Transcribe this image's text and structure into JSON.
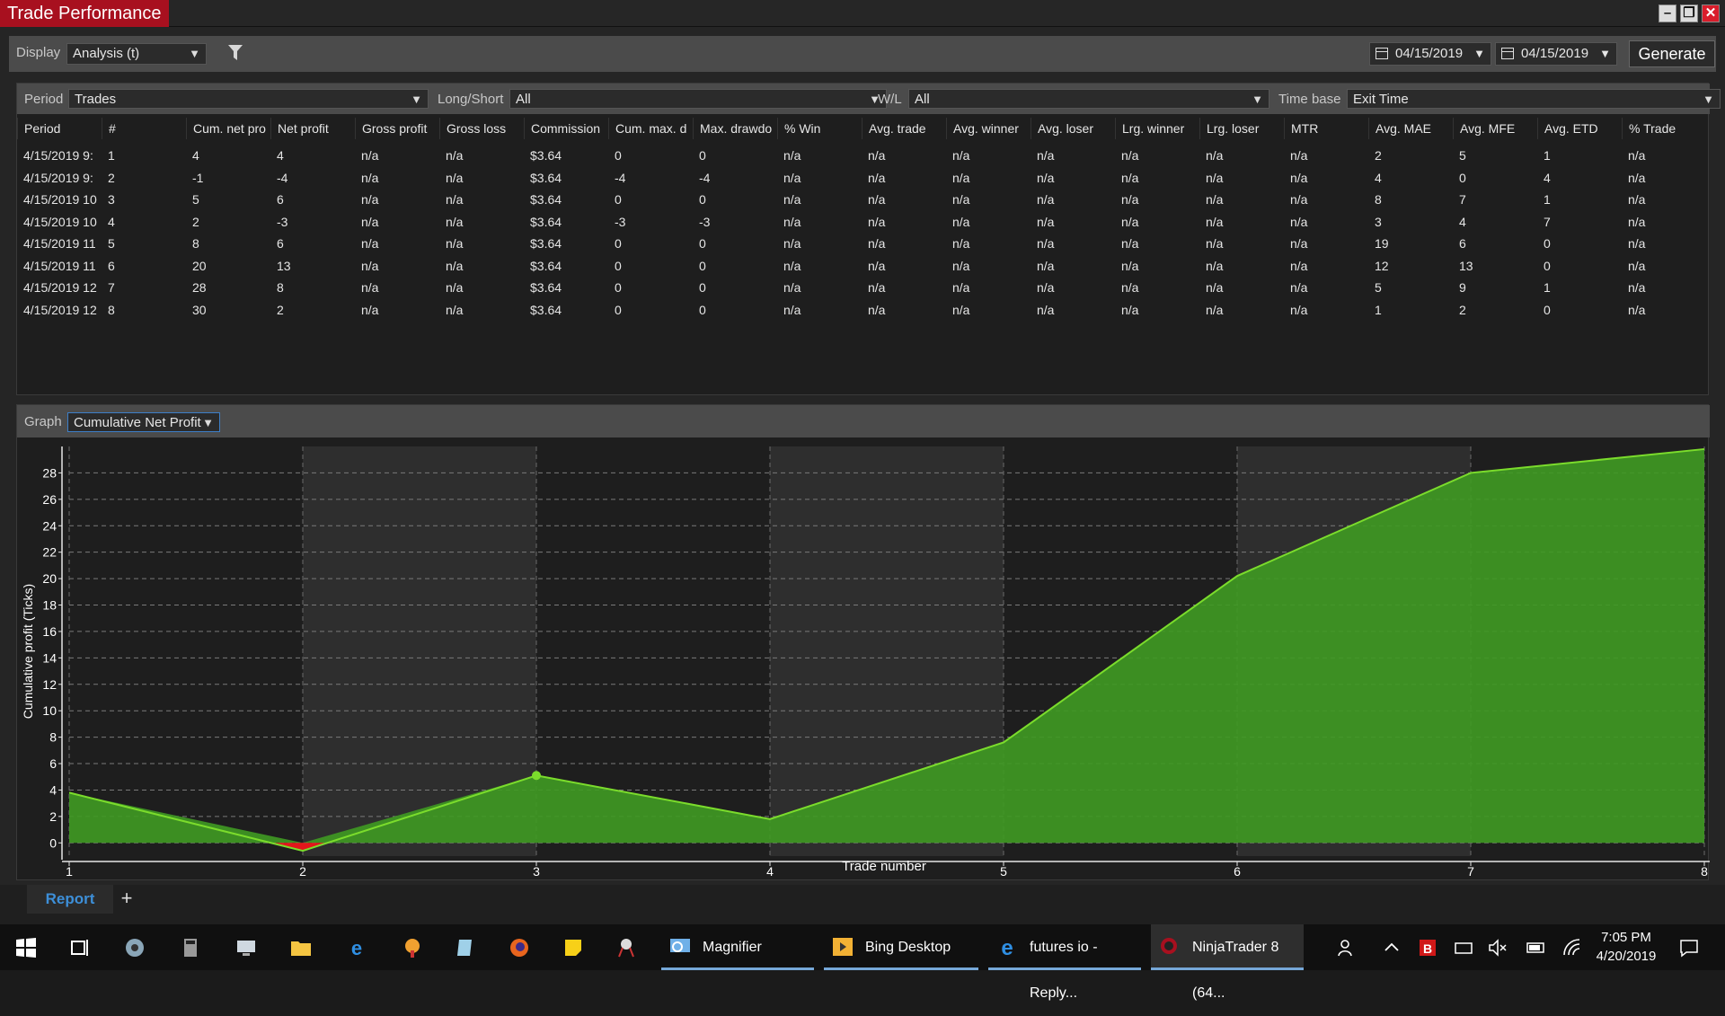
{
  "window": {
    "title": "Trade Performance"
  },
  "display_bar": {
    "label": "Display",
    "value": "Analysis (t)",
    "date_from": "04/15/2019",
    "date_to": "04/15/2019",
    "generate_label": "Generate"
  },
  "filters": {
    "period_label": "Period",
    "period_value": "Trades",
    "longshort_label": "Long/Short",
    "longshort_value": "All",
    "wl_label": "W/L",
    "wl_value": "All",
    "timebase_label": "Time base",
    "timebase_value": "Exit Time"
  },
  "table": {
    "columns": [
      "Period",
      "#",
      "Cum. net pro",
      "Net profit",
      "Gross profit",
      "Gross loss",
      "Commission",
      "Cum. max. d",
      "Max. drawdo",
      "% Win",
      "Avg. trade",
      "Avg. winner",
      "Avg. loser",
      "Lrg. winner",
      "Lrg. loser",
      "MTR",
      "Avg. MAE",
      "Avg. MFE",
      "Avg. ETD",
      "% Trade"
    ],
    "rows": [
      [
        "4/15/2019 9:",
        "1",
        "4",
        "4",
        "n/a",
        "n/a",
        "$3.64",
        "0",
        "0",
        "n/a",
        "n/a",
        "n/a",
        "n/a",
        "n/a",
        "n/a",
        "n/a",
        "2",
        "5",
        "1",
        "n/a"
      ],
      [
        "4/15/2019 9:",
        "2",
        "-1",
        "-4",
        "n/a",
        "n/a",
        "$3.64",
        "-4",
        "-4",
        "n/a",
        "n/a",
        "n/a",
        "n/a",
        "n/a",
        "n/a",
        "n/a",
        "4",
        "0",
        "4",
        "n/a"
      ],
      [
        "4/15/2019 10",
        "3",
        "5",
        "6",
        "n/a",
        "n/a",
        "$3.64",
        "0",
        "0",
        "n/a",
        "n/a",
        "n/a",
        "n/a",
        "n/a",
        "n/a",
        "n/a",
        "8",
        "7",
        "1",
        "n/a"
      ],
      [
        "4/15/2019 10",
        "4",
        "2",
        "-3",
        "n/a",
        "n/a",
        "$3.64",
        "-3",
        "-3",
        "n/a",
        "n/a",
        "n/a",
        "n/a",
        "n/a",
        "n/a",
        "n/a",
        "3",
        "4",
        "7",
        "n/a"
      ],
      [
        "4/15/2019 11",
        "5",
        "8",
        "6",
        "n/a",
        "n/a",
        "$3.64",
        "0",
        "0",
        "n/a",
        "n/a",
        "n/a",
        "n/a",
        "n/a",
        "n/a",
        "n/a",
        "19",
        "6",
        "0",
        "n/a"
      ],
      [
        "4/15/2019 11",
        "6",
        "20",
        "13",
        "n/a",
        "n/a",
        "$3.64",
        "0",
        "0",
        "n/a",
        "n/a",
        "n/a",
        "n/a",
        "n/a",
        "n/a",
        "n/a",
        "12",
        "13",
        "0",
        "n/a"
      ],
      [
        "4/15/2019 12",
        "7",
        "28",
        "8",
        "n/a",
        "n/a",
        "$3.64",
        "0",
        "0",
        "n/a",
        "n/a",
        "n/a",
        "n/a",
        "n/a",
        "n/a",
        "n/a",
        "5",
        "9",
        "1",
        "n/a"
      ],
      [
        "4/15/2019 12",
        "8",
        "30",
        "2",
        "n/a",
        "n/a",
        "$3.64",
        "0",
        "0",
        "n/a",
        "n/a",
        "n/a",
        "n/a",
        "n/a",
        "n/a",
        "n/a",
        "1",
        "2",
        "0",
        "n/a"
      ]
    ]
  },
  "graph_bar": {
    "label": "Graph",
    "value": "Cumulative Net Profit"
  },
  "chart_data": {
    "type": "area",
    "x": [
      1,
      2,
      3,
      4,
      5,
      6,
      7,
      8
    ],
    "values": [
      3.8,
      -0.6,
      5.1,
      1.8,
      7.6,
      20.2,
      28.0,
      29.8
    ],
    "xlabel": "Trade number",
    "ylabel": "Cumulative profit (Ticks)",
    "xlim": [
      1,
      8
    ],
    "ylim": [
      -1,
      30
    ],
    "yticks": [
      0,
      2,
      4,
      6,
      8,
      10,
      12,
      14,
      16,
      18,
      20,
      22,
      24,
      26,
      28
    ],
    "xticks": [
      1,
      2,
      3,
      4,
      5,
      6,
      7,
      8
    ],
    "grid": true,
    "colors": {
      "fill": "#3f9a22",
      "line": "#7bdc2c",
      "negative": "#e3161b"
    }
  },
  "tabs": {
    "report_label": "Report",
    "add_label": "+"
  },
  "taskbar": {
    "tasks": [
      "Magnifier",
      "Bing Desktop",
      "futures io - Reply...",
      "NinjaTrader 8 (64..."
    ],
    "time": "7:05 PM",
    "date": "4/20/2019"
  }
}
